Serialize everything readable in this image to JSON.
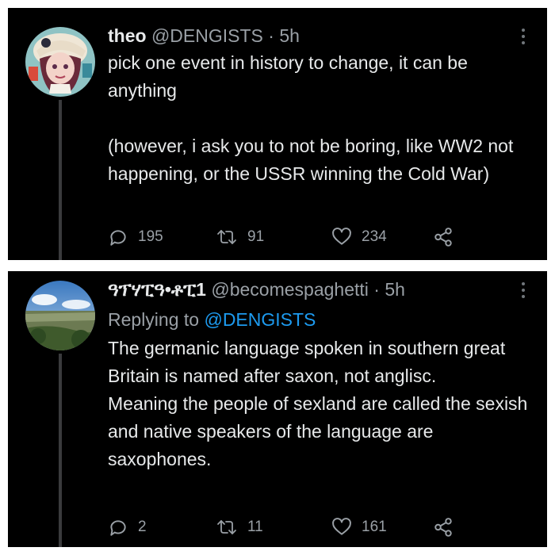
{
  "tweets": [
    {
      "name": "theo",
      "handle": "@DENGISTS",
      "separator": "·",
      "time": "5h",
      "body": [
        "pick one event in history to change, it can be anything",
        "",
        "(however, i ask you to not be boring, like WW2 not happening, or the USSR winning the Cold War)"
      ],
      "replies": "195",
      "retweets": "91",
      "likes": "234"
    },
    {
      "name": "ዓፕሃፒዓ•ቶፒ1",
      "handle": "@becomespaghetti",
      "separator": "·",
      "time": "5h",
      "replying_label": "Replying to",
      "replying_to": "@DENGISTS",
      "body": [
        "The germanic language spoken in southern great Britain is named after saxon, not anglisc.",
        "Meaning the people of sexland are called the sexish and native speakers of the language are saxophones."
      ],
      "replies": "2",
      "retweets": "11",
      "likes": "161"
    }
  ],
  "colors": {
    "background": "#000000",
    "text": "#e7e9ea",
    "muted": "#9aa0a6",
    "link": "#1d9bf0"
  },
  "icons": [
    "reply-icon",
    "retweet-icon",
    "like-icon",
    "share-icon",
    "more-icon"
  ]
}
